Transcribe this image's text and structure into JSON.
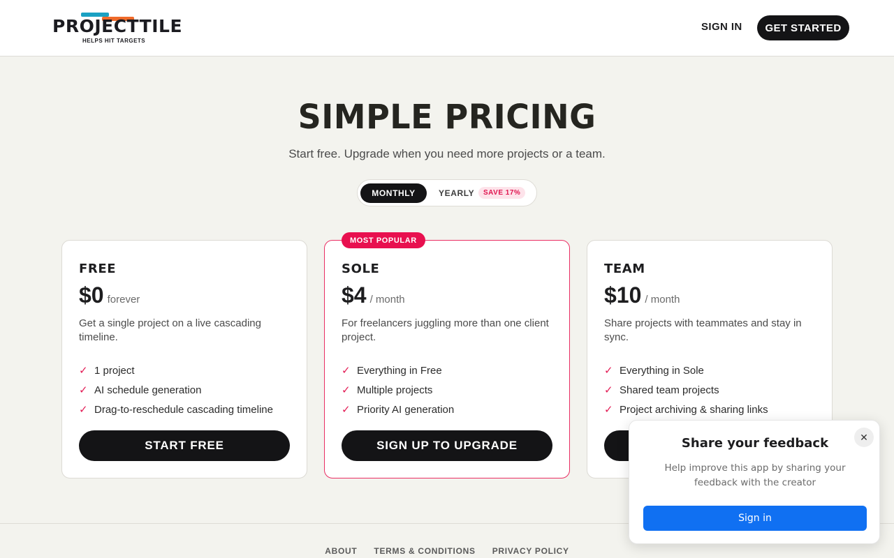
{
  "header": {
    "logo_text": "PROJECTTILE",
    "logo_tagline": "HELPS HIT TARGETS",
    "sign_in": "SIGN IN",
    "get_started": "GET STARTED"
  },
  "hero": {
    "title": "SIMPLE PRICING",
    "subtitle": "Start free. Upgrade when you need more projects or a team."
  },
  "billing_toggle": {
    "monthly": "MONTHLY",
    "yearly": "YEARLY",
    "save_badge": "SAVE 17%",
    "selected": "MONTHLY"
  },
  "plans": [
    {
      "name": "FREE",
      "price": "$0",
      "period": "forever",
      "description": "Get a single project on a live cascading timeline.",
      "features": [
        "1 project",
        "AI schedule generation",
        "Drag-to-reschedule cascading timeline"
      ],
      "button": "START FREE"
    },
    {
      "name": "SOLE",
      "badge": "MOST POPULAR",
      "price": "$4",
      "period": "/ month",
      "description": "For freelancers juggling more than one client project.",
      "features": [
        "Everything in Free",
        "Multiple projects",
        "Priority AI generation"
      ],
      "button": "SIGN UP TO UPGRADE"
    },
    {
      "name": "TEAM",
      "price": "$10",
      "period": "/ month",
      "description": "Share projects with teammates and stay in sync.",
      "features": [
        "Everything in Sole",
        "Shared team projects",
        "Project archiving & sharing links"
      ],
      "button": ""
    }
  ],
  "footer": {
    "links": [
      "ABOUT",
      "TERMS & CONDITIONS",
      "PRIVACY POLICY"
    ]
  },
  "feedback": {
    "close": "✕",
    "title": "Share your feedback",
    "text": "Help improve this app by sharing your feedback with the creator",
    "button": "Sign in"
  },
  "colors": {
    "accent": "#e8104f",
    "dark": "#141416",
    "background": "#f3f3ee",
    "feedback_button": "#1070f2"
  },
  "icons": {
    "check": "check-icon",
    "close": "close-icon"
  }
}
